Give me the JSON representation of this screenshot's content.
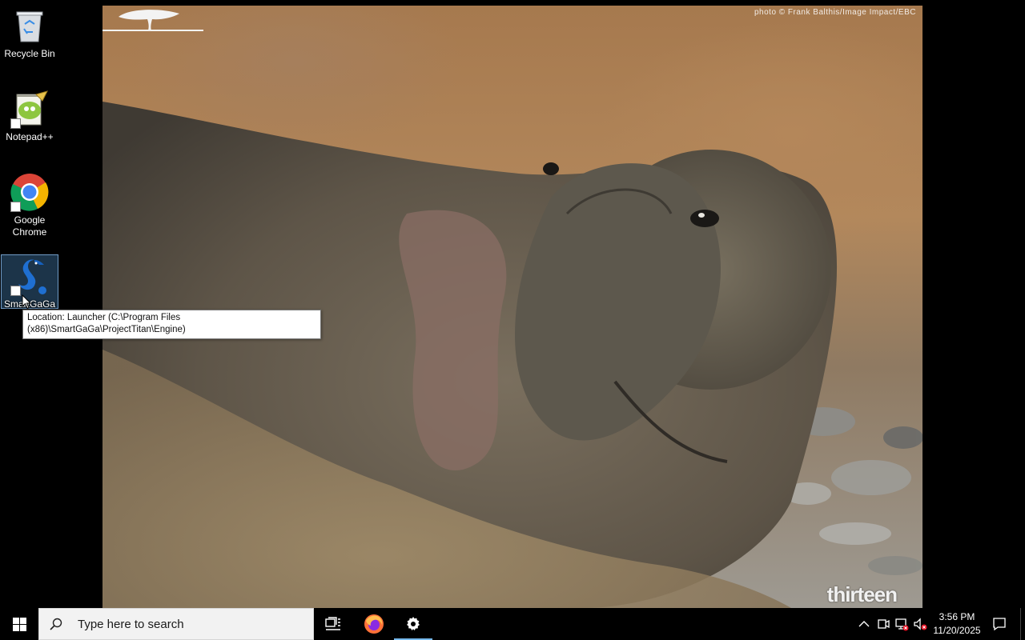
{
  "desktop": {
    "icons": [
      {
        "label": "Recycle Bin",
        "icon": "recycle-bin-icon"
      },
      {
        "label": "Notepad++",
        "icon": "notepad-plus-plus-icon"
      },
      {
        "label": "Google Chrome",
        "icon": "chrome-icon"
      },
      {
        "label": "SmartGaGa",
        "icon": "smartgaga-icon"
      }
    ],
    "tooltip": "Location: Launcher (C:\\Program Files (x86)\\SmartGaGa\\ProjectTitan\\Engine)"
  },
  "wallpaper": {
    "credit": "photo © Frank Balthis/Image Impact/EBC",
    "logo_text": "thirteen"
  },
  "taskbar": {
    "search_placeholder": "Type here to search",
    "pinned": [
      {
        "name": "Task View",
        "icon": "task-view-icon"
      },
      {
        "name": "Firefox",
        "icon": "firefox-icon"
      },
      {
        "name": "Settings",
        "icon": "gear-icon"
      }
    ],
    "active_app": "Settings",
    "clock": {
      "time": "3:56 PM",
      "date": "11/20/2025"
    },
    "tray_icons": [
      "chevron-up-icon",
      "meet-now-icon",
      "network-icon",
      "volume-muted-icon",
      "notification-icon"
    ],
    "accent_color": "#76b9ed"
  }
}
